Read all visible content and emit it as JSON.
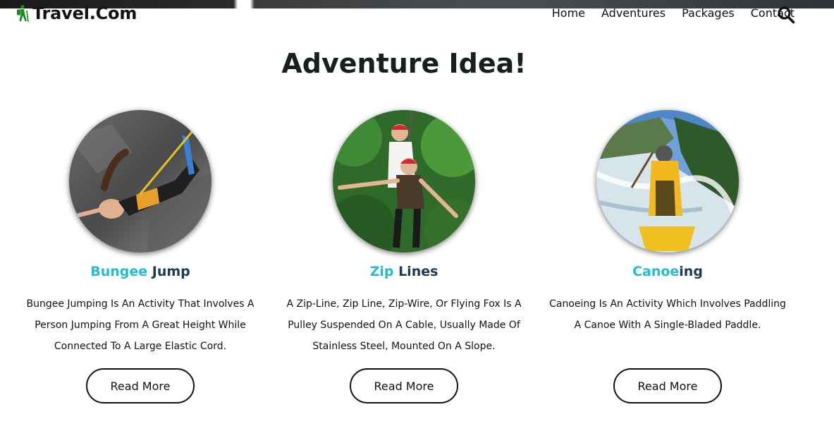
{
  "brand": {
    "name": "Travel.Com",
    "logo_icon": "hiker-icon",
    "logo_color": "#1a8a1a"
  },
  "nav": {
    "items": [
      {
        "label": "Home"
      },
      {
        "label": "Adventures"
      },
      {
        "label": "Packages"
      },
      {
        "label": "Contact"
      }
    ],
    "search_icon": "search-icon"
  },
  "section": {
    "title": "Adventure Idea!"
  },
  "cards": [
    {
      "title_part1": "Bungee",
      "title_part2": " Jump",
      "description": "Bungee Jumping Is An Activity That Involves A Person Jumping From A Great Height While Connected To A Large Elastic Cord.",
      "button_label": "Read More",
      "image": "bungee-jump-photo"
    },
    {
      "title_part1": "Zip",
      "title_part2": " Lines",
      "description": "A Zip-Line, Zip Line, Zip-Wire, Or Flying Fox Is A Pulley Suspended On A Cable, Usually Made Of Stainless Steel, Mounted On A Slope.",
      "button_label": "Read More",
      "image": "zip-line-photo"
    },
    {
      "title_part1": "Canoe",
      "title_part2": "ing",
      "description": "Canoeing Is An Activity Which Involves Paddling A Canoe With A Single-Bladed Paddle.",
      "button_label": "Read More",
      "image": "canoeing-photo"
    }
  ],
  "colors": {
    "title_accent": "#23bcd2",
    "title_dark": "#1d3a57",
    "heading": "#17201d"
  }
}
